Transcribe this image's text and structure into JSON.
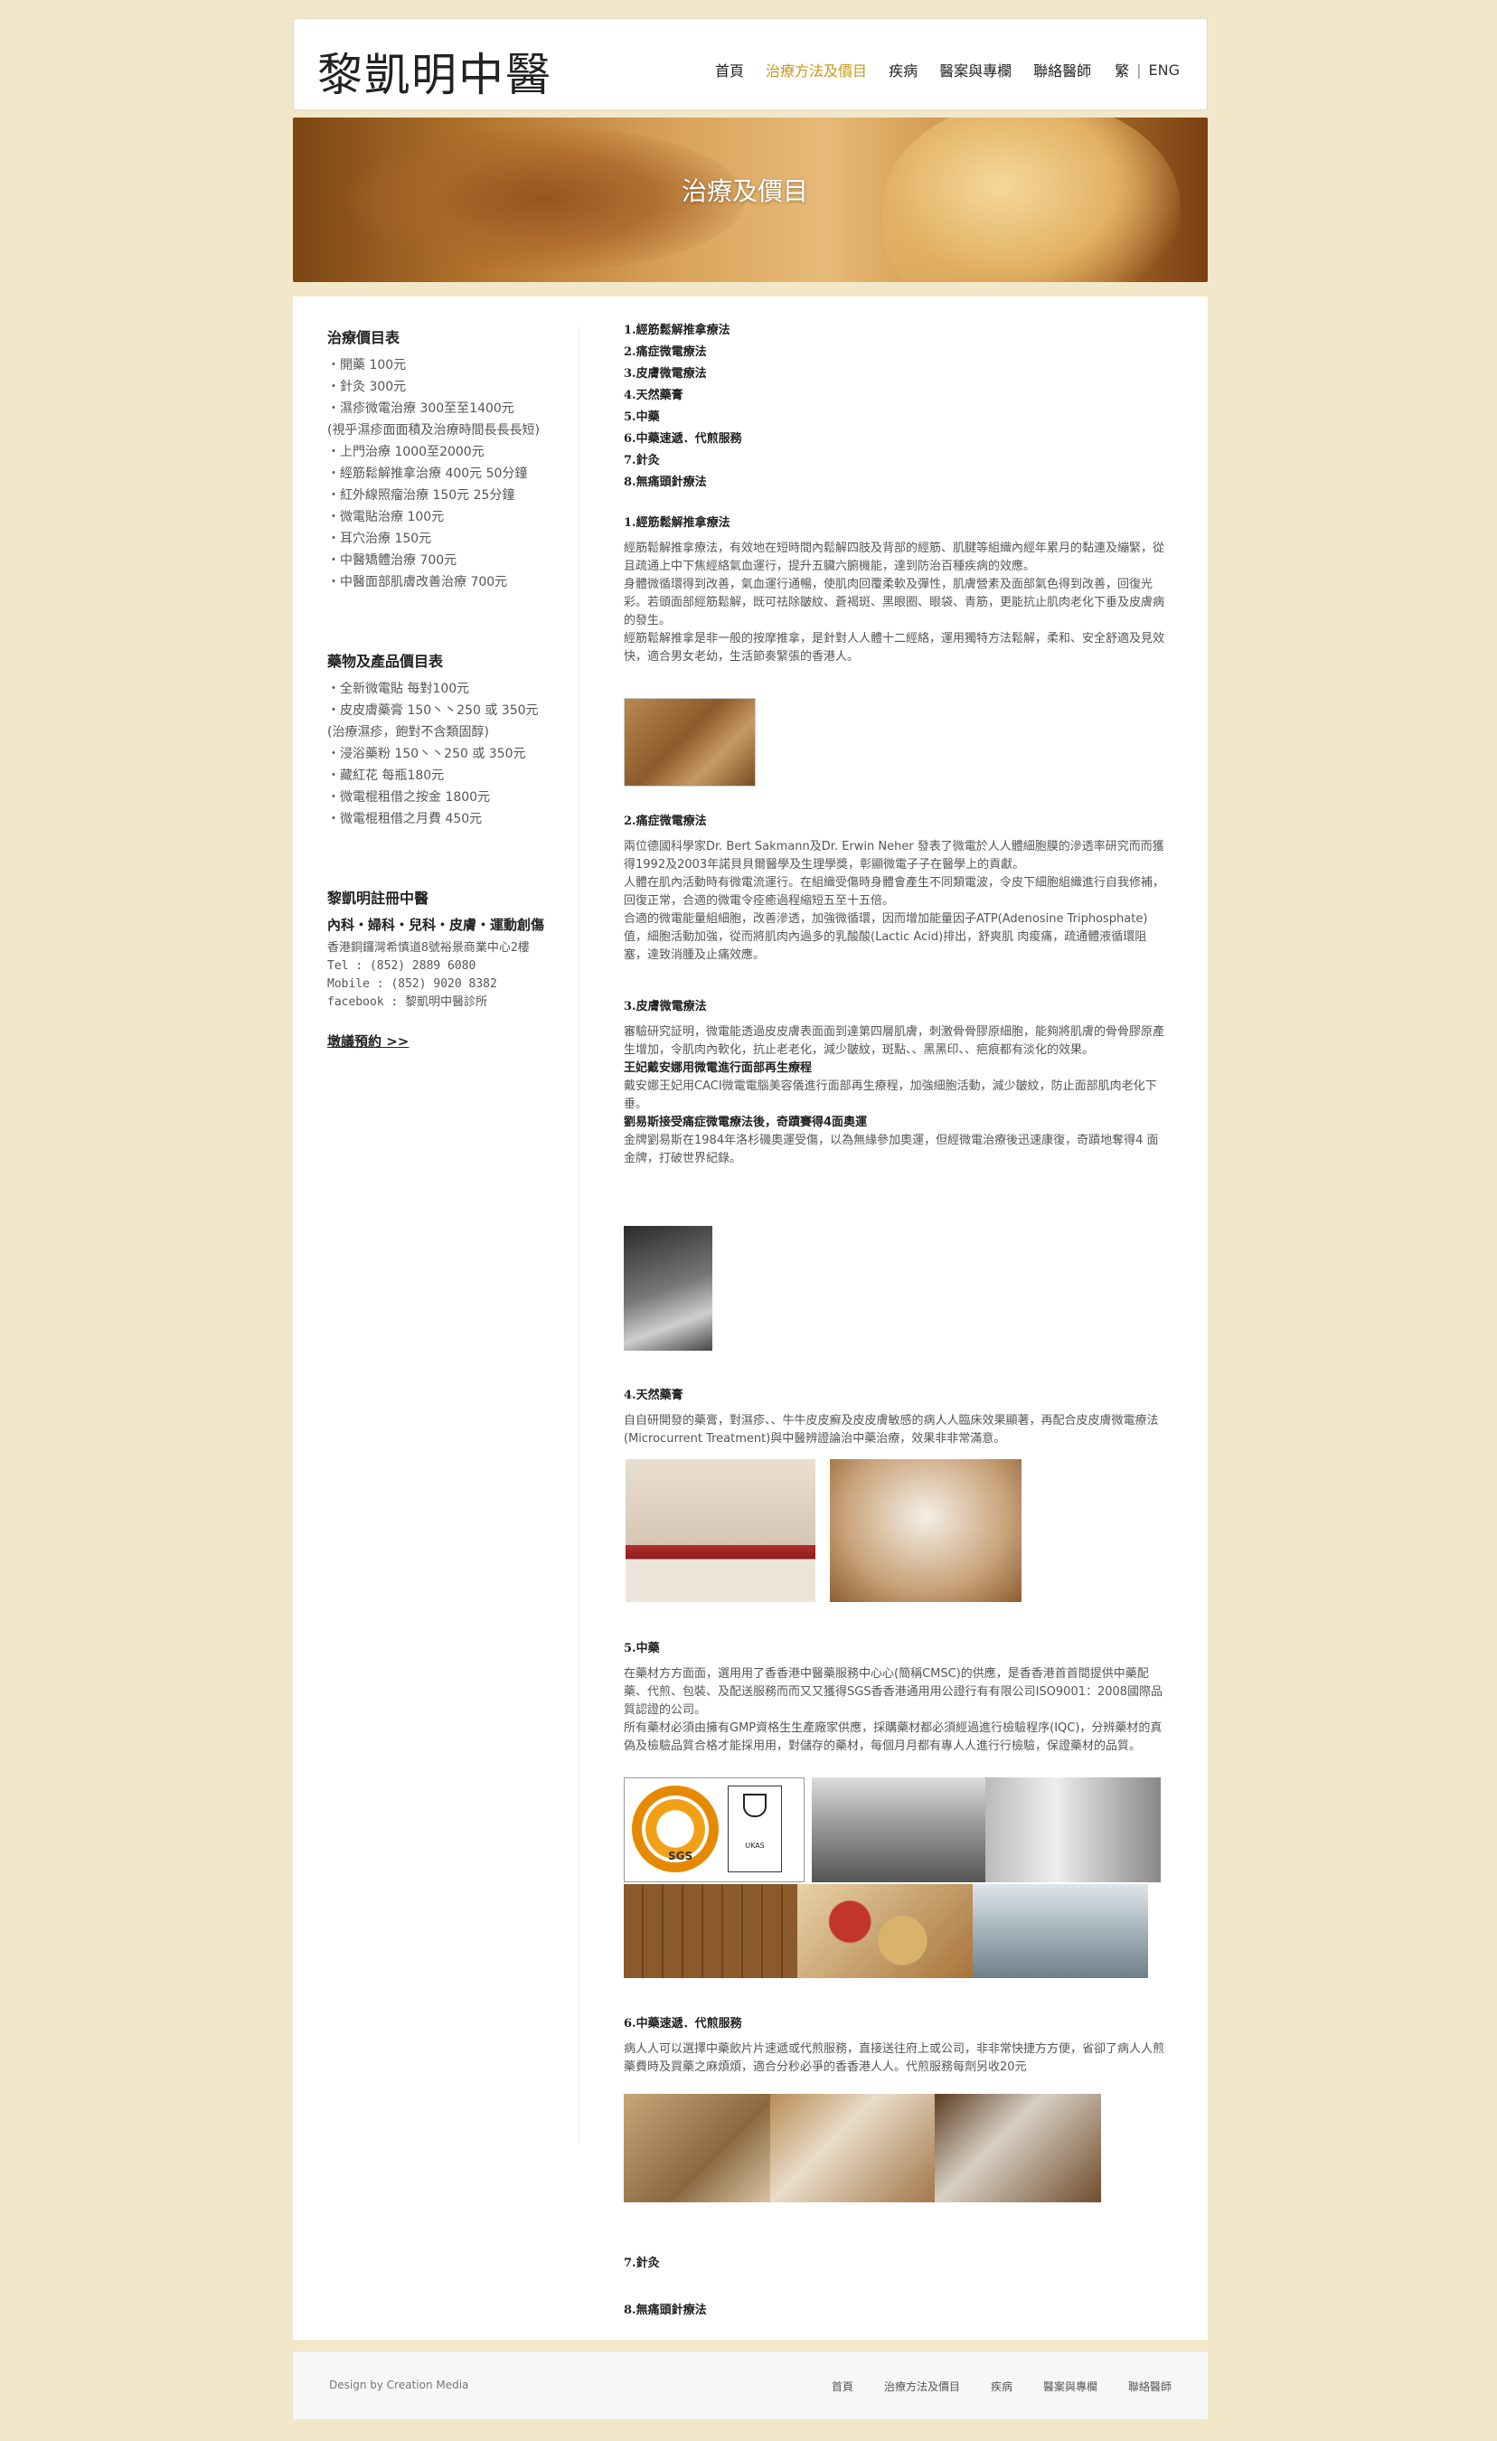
{
  "header": {
    "logo": "黎凱明中醫",
    "nav": [
      "首頁",
      "治療方法及價目",
      "疾病",
      "醫案與專欄",
      "聯絡醫師"
    ],
    "active": "治療方法及價目",
    "lang_trad": "繁",
    "lang_sep": "|",
    "lang_eng": "ENG"
  },
  "banner": {
    "title": "治療及價目"
  },
  "sidebar": {
    "prices": {
      "title": "治療價目表",
      "items": [
        "・開藥 100元",
        "・針灸 300元",
        "・濕疹微電治療 300至至1400元",
        "(視乎濕疹面面積及治療時間長長長短)",
        "・上門治療 1000至2000元",
        "・經筋鬆解推拿治療 400元 50分鐘",
        "・紅外線照瘤治療 150元 25分鐘",
        "・微電貼治療 100元",
        "・耳穴治療 150元",
        "・中醫矯體治療 700元",
        "・中醫面部肌膚改善治療 700元"
      ]
    },
    "products": {
      "title": "藥物及產品價目表",
      "items": [
        "・全新微電貼 每對100元",
        "・皮皮膚藥膏 150丶丶250 或 350元",
        "  (治療濕疹，飽對不含類固醇)",
        "・浸浴藥粉 150丶丶250 或 350元",
        "・藏紅花 每瓶180元",
        "・微電棍租借之按金 1800元",
        "・微電棍租借之月費 450元"
      ]
    },
    "clinic": {
      "title": "黎凱明註冊中醫",
      "subtitle": "內科・婦科・兒科・皮膚・運動創傷",
      "address": [
        "香港銅鑼灣希慎道8號裕景商業中心2樓",
        "Tel      : (852) 2889 6080",
        "Mobile   : (852) 9020 8382",
        "facebook : 黎凱明中醫診所"
      ],
      "book": "墩議預約 >>"
    }
  },
  "toc": [
    "1.經筋鬆解推拿療法",
    "2.痛症微電療法",
    "3.皮膚微電療法",
    "4.天然藥膏",
    "5.中藥",
    "6.中藥速遞．代煎服務",
    "7.針灸",
    "8.無痛頭針療法"
  ],
  "sections": {
    "s1": {
      "title": "1.經筋鬆解推拿療法",
      "paras": [
        "經筋鬆解推拿療法，有效地在短時間內鬆解四肢及背部的經筋、肌腱等組織內經年累月的黏連及繃緊，從且疏通上中下焦經絡氣血運行，提升五臟六腑機能，達到防治百種疾病的效應。",
        "身體微循環得到改善，氣血運行通暢，使肌肉回覆柔軟及彈性，肌膚營素及面部氣色得到改善，回復光彩。若頭面部經筋鬆解，既可祛除皺紋、蒼褐斑、黑眼圈、眼袋、青筋，更能抗止肌肉老化下垂及皮膚病的發生。",
        "經筋鬆解推拿是非一般的按摩推拿，是針對人人體十二經絡，運用獨特方法鬆解，柔和、安全舒適及見效快，適合男女老幼，生活節奏緊張的香港人。"
      ]
    },
    "s2": {
      "title": "2.痛症微電療法",
      "paras": [
        "兩位德國科學家Dr. Bert Sakmann及Dr. Erwin Neher 發表了微電於人人體細胞膜的滲透率研究而而獲得1992及2003年諾貝貝爾醫學及生理學獎，彰顯微電子子在醫學上的貢獻。",
        "人體在肌內活動時有微電流運行。在組織受傷時身體會產生不同類電波，令皮下細胞組織進行自我修補，回復正常，合適的微電令痊癒過程縮短五至十五倍。",
        "合適的微電能量組細胞，改善滲透，加強微循環，因而增加能量因子ATP(Adenosine Triphosphate)值，細胞活動加強，從而將肌肉內過多的乳酸酸(Lactic Acid)排出，舒爽肌 肉痠痛，疏通體液循環阻塞，達致消腫及止痛效應。"
      ]
    },
    "s3": {
      "title": "3.皮膚微電療法",
      "p1": "審驗研究証明，微電能透過皮皮膚表面面到達第四層肌膚，刺激骨骨膠原細胞，能夠將肌膚的骨骨膠原產生增加，令肌肉內軟化，抗止老老化，減少皺紋，斑點、、黑黑印、、疤痕都有淡化的效果。",
      "sub1": "王妃戴安娜用微電進行面部再生療程",
      "p2": "戴安娜王妃用CACI微電電腦美容儀進行面部再生療程，加強細胞活動，減少皺紋，防止面部肌肉老化下垂。",
      "sub2": "劉易斯接受痛症微電療法後，奇蹟賽得4面奧運",
      "p3": "金牌劉易斯在1984年洛杉磯奧運受傷，以為無緣參加奧運，但經微電治療後迅速康復，奇蹟地奪得4 面 金牌，打破世界紀錄。"
    },
    "s4": {
      "title": "4.天然藥膏",
      "p": "自自研開發的藥膏，對濕疹、、牛牛皮皮癬及皮皮膚敏感的病人人臨床效果顯著，再配合皮皮膚微電療法(Microcurrent Treatment)與中醫辨證論治中藥治療，效果非非常滿意。"
    },
    "s5": {
      "title": "5.中藥",
      "paras": [
        "在藥材方方面面，選用用了香香港中醫藥服務中心心(簡稱CMSC)的供應，是香香港首首間提供中藥配藥、代煎、包裝、及配送服務而而又又獲得SGS香香港通用用公證行有有限公司ISO9001：2008國際品質認證的公司。",
        "所有藥材必須由擁有GMP資格生生產廠家供應，採購藥材都必須經過進行檢驗程序(IQC)，分辨藥材的真偽及檢驗品質合格才能採用用，對儲存的藥材，每個月月都有專人人進行行檢驗，保證藥材的品質。"
      ],
      "cert_sgs": "SGS",
      "cert_ukas": "UKAS"
    },
    "s6": {
      "title": "6.中藥速遞．代煎服務",
      "p": "病人人可以選擇中藥飲片片速遞或代煎服務，直接送往府上或公司，非非常快捷方方便，省卻了病人人煎藥費時及買藥之麻煩煩，適合分秒必爭的香香港人人。代煎服務每劑另收20元"
    },
    "s7": {
      "title": "7.針灸"
    },
    "s8": {
      "title": "8.無痛頭針療法"
    }
  },
  "footer": {
    "credit": "Design by Creation Media",
    "nav": [
      "首頁",
      "治療方法及價目",
      "疾病",
      "醫案與專欄",
      "聯絡醫師"
    ]
  }
}
